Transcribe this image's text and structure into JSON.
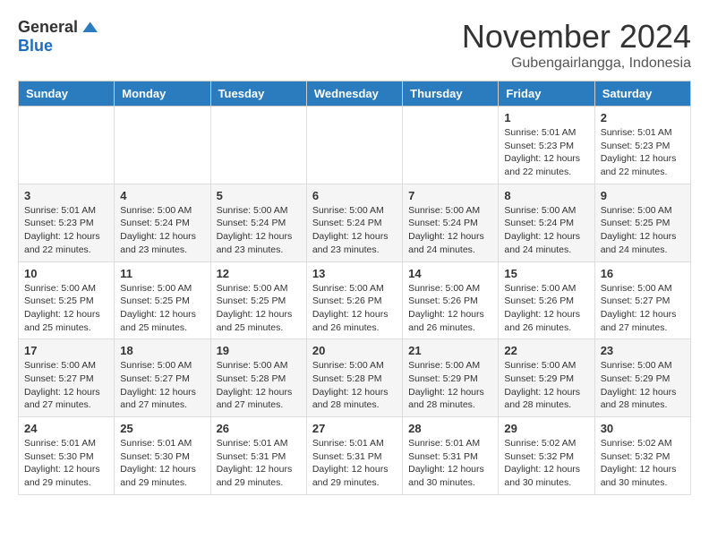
{
  "header": {
    "logo_general": "General",
    "logo_blue": "Blue",
    "month_title": "November 2024",
    "subtitle": "Gubengairlangga, Indonesia"
  },
  "calendar": {
    "days_of_week": [
      "Sunday",
      "Monday",
      "Tuesday",
      "Wednesday",
      "Thursday",
      "Friday",
      "Saturday"
    ],
    "weeks": [
      [
        {
          "day": "",
          "info": ""
        },
        {
          "day": "",
          "info": ""
        },
        {
          "day": "",
          "info": ""
        },
        {
          "day": "",
          "info": ""
        },
        {
          "day": "",
          "info": ""
        },
        {
          "day": "1",
          "info": "Sunrise: 5:01 AM\nSunset: 5:23 PM\nDaylight: 12 hours\nand 22 minutes."
        },
        {
          "day": "2",
          "info": "Sunrise: 5:01 AM\nSunset: 5:23 PM\nDaylight: 12 hours\nand 22 minutes."
        }
      ],
      [
        {
          "day": "3",
          "info": "Sunrise: 5:01 AM\nSunset: 5:23 PM\nDaylight: 12 hours\nand 22 minutes."
        },
        {
          "day": "4",
          "info": "Sunrise: 5:00 AM\nSunset: 5:24 PM\nDaylight: 12 hours\nand 23 minutes."
        },
        {
          "day": "5",
          "info": "Sunrise: 5:00 AM\nSunset: 5:24 PM\nDaylight: 12 hours\nand 23 minutes."
        },
        {
          "day": "6",
          "info": "Sunrise: 5:00 AM\nSunset: 5:24 PM\nDaylight: 12 hours\nand 23 minutes."
        },
        {
          "day": "7",
          "info": "Sunrise: 5:00 AM\nSunset: 5:24 PM\nDaylight: 12 hours\nand 24 minutes."
        },
        {
          "day": "8",
          "info": "Sunrise: 5:00 AM\nSunset: 5:24 PM\nDaylight: 12 hours\nand 24 minutes."
        },
        {
          "day": "9",
          "info": "Sunrise: 5:00 AM\nSunset: 5:25 PM\nDaylight: 12 hours\nand 24 minutes."
        }
      ],
      [
        {
          "day": "10",
          "info": "Sunrise: 5:00 AM\nSunset: 5:25 PM\nDaylight: 12 hours\nand 25 minutes."
        },
        {
          "day": "11",
          "info": "Sunrise: 5:00 AM\nSunset: 5:25 PM\nDaylight: 12 hours\nand 25 minutes."
        },
        {
          "day": "12",
          "info": "Sunrise: 5:00 AM\nSunset: 5:25 PM\nDaylight: 12 hours\nand 25 minutes."
        },
        {
          "day": "13",
          "info": "Sunrise: 5:00 AM\nSunset: 5:26 PM\nDaylight: 12 hours\nand 26 minutes."
        },
        {
          "day": "14",
          "info": "Sunrise: 5:00 AM\nSunset: 5:26 PM\nDaylight: 12 hours\nand 26 minutes."
        },
        {
          "day": "15",
          "info": "Sunrise: 5:00 AM\nSunset: 5:26 PM\nDaylight: 12 hours\nand 26 minutes."
        },
        {
          "day": "16",
          "info": "Sunrise: 5:00 AM\nSunset: 5:27 PM\nDaylight: 12 hours\nand 27 minutes."
        }
      ],
      [
        {
          "day": "17",
          "info": "Sunrise: 5:00 AM\nSunset: 5:27 PM\nDaylight: 12 hours\nand 27 minutes."
        },
        {
          "day": "18",
          "info": "Sunrise: 5:00 AM\nSunset: 5:27 PM\nDaylight: 12 hours\nand 27 minutes."
        },
        {
          "day": "19",
          "info": "Sunrise: 5:00 AM\nSunset: 5:28 PM\nDaylight: 12 hours\nand 27 minutes."
        },
        {
          "day": "20",
          "info": "Sunrise: 5:00 AM\nSunset: 5:28 PM\nDaylight: 12 hours\nand 28 minutes."
        },
        {
          "day": "21",
          "info": "Sunrise: 5:00 AM\nSunset: 5:29 PM\nDaylight: 12 hours\nand 28 minutes."
        },
        {
          "day": "22",
          "info": "Sunrise: 5:00 AM\nSunset: 5:29 PM\nDaylight: 12 hours\nand 28 minutes."
        },
        {
          "day": "23",
          "info": "Sunrise: 5:00 AM\nSunset: 5:29 PM\nDaylight: 12 hours\nand 28 minutes."
        }
      ],
      [
        {
          "day": "24",
          "info": "Sunrise: 5:01 AM\nSunset: 5:30 PM\nDaylight: 12 hours\nand 29 minutes."
        },
        {
          "day": "25",
          "info": "Sunrise: 5:01 AM\nSunset: 5:30 PM\nDaylight: 12 hours\nand 29 minutes."
        },
        {
          "day": "26",
          "info": "Sunrise: 5:01 AM\nSunset: 5:31 PM\nDaylight: 12 hours\nand 29 minutes."
        },
        {
          "day": "27",
          "info": "Sunrise: 5:01 AM\nSunset: 5:31 PM\nDaylight: 12 hours\nand 29 minutes."
        },
        {
          "day": "28",
          "info": "Sunrise: 5:01 AM\nSunset: 5:31 PM\nDaylight: 12 hours\nand 30 minutes."
        },
        {
          "day": "29",
          "info": "Sunrise: 5:02 AM\nSunset: 5:32 PM\nDaylight: 12 hours\nand 30 minutes."
        },
        {
          "day": "30",
          "info": "Sunrise: 5:02 AM\nSunset: 5:32 PM\nDaylight: 12 hours\nand 30 minutes."
        }
      ]
    ]
  }
}
